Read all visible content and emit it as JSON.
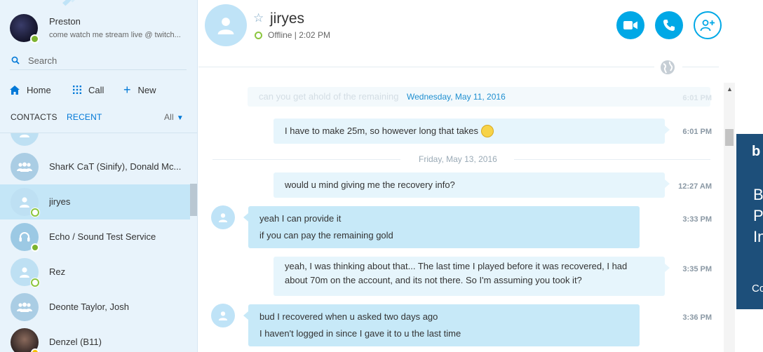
{
  "profile": {
    "name": "Preston",
    "mood": "come watch me stream live @ twitch...",
    "status": "online"
  },
  "search": {
    "placeholder": "Search"
  },
  "nav": {
    "home": "Home",
    "call": "Call",
    "new": "New"
  },
  "tabs": {
    "contacts": "CONTACTS",
    "recent": "RECENT",
    "filter": "All"
  },
  "contacts": [
    {
      "name": "",
      "type": "person",
      "status": "none"
    },
    {
      "name": "SharK CaT (Sinify), Donald Mc...",
      "type": "group",
      "status": "none"
    },
    {
      "name": "jiryes",
      "type": "person",
      "status": "offline",
      "selected": true
    },
    {
      "name": "Echo / Sound Test Service",
      "type": "bot",
      "status": "online"
    },
    {
      "name": "Rez",
      "type": "person",
      "status": "offline"
    },
    {
      "name": "Deonte Taylor, Josh",
      "type": "group",
      "status": "none"
    },
    {
      "name": "Denzel (B11)",
      "type": "person",
      "status": "away"
    }
  ],
  "chat": {
    "name": "jiryes",
    "status": "Offline | 2:02 PM",
    "buttons": [
      "video-call",
      "audio-call",
      "add-people"
    ]
  },
  "conversation": {
    "faded_text": "can you get ahold of the remaining",
    "faded_time": "6:01 PM",
    "date1": "Wednesday, May 11, 2016",
    "date2": "Friday, May 13, 2016",
    "messages": [
      {
        "dir": "out",
        "lines": [
          "I have to make 25m, so however long that takes"
        ],
        "emoji": "smile",
        "time": "6:01 PM"
      },
      {
        "dir": "out",
        "lines": [
          "would u mind giving me the recovery info?"
        ],
        "time": "12:27 AM"
      },
      {
        "dir": "in",
        "lines": [
          "yeah I can provide it",
          "if you can pay the remaining gold"
        ],
        "time": "3:33 PM"
      },
      {
        "dir": "out",
        "lines": [
          "yeah, I was thinking about that... The last time I played before it was recovered, I had",
          "about 70m on the account, and its not there. So I'm assuming you took it?"
        ],
        "time": "3:35 PM"
      },
      {
        "dir": "in",
        "lines": [
          "bud I recovered when u asked two days ago",
          "I haven't logged in since I gave it to u the last time"
        ],
        "time": "3:36 PM"
      }
    ]
  },
  "ad": {
    "logo": "b",
    "lines": [
      "B",
      "P",
      "In"
    ],
    "footer": "Co"
  }
}
